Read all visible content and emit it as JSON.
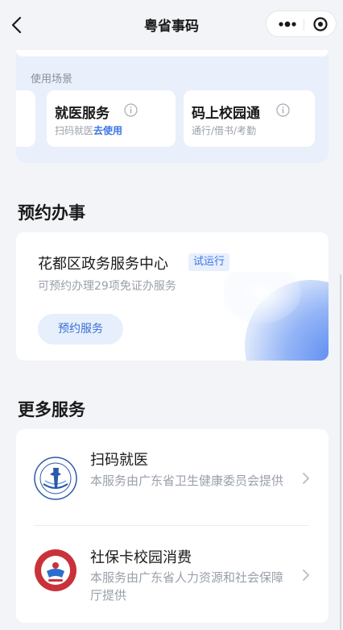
{
  "nav": {
    "title": "粤省事码",
    "back_icon": "chevron-left-icon",
    "more_icon": "more-dots-icon",
    "close_icon": "target-circle-icon"
  },
  "scene": {
    "label": "使用场景",
    "chips": [
      {
        "title": "就医服务",
        "sub_prefix": "扫码就医",
        "sub_link": "去使用",
        "info_icon": "info-icon"
      },
      {
        "title": "码上校园通",
        "sub": "通行/借书/考勤",
        "info_icon": "info-icon"
      }
    ]
  },
  "booking": {
    "section_title": "预约办事",
    "center_name": "花都区政务服务中心",
    "badge": "试运行",
    "desc": "可预约办理29项免证办服务",
    "button": "预约服务"
  },
  "more": {
    "section_title": "更多服务",
    "items": [
      {
        "title": "扫码就医",
        "desc": "本服务由广东省卫生健康委员会提供",
        "logo": "health-commission-logo-icon"
      },
      {
        "title": "社保卡校园消费",
        "desc": "本服务由广东省人力资源和社会保障厅提供",
        "logo": "social-security-card-logo-icon"
      }
    ]
  },
  "colors": {
    "accent": "#3a74e6",
    "bg": "#f2f4f7",
    "muted": "#9aa0aa"
  }
}
